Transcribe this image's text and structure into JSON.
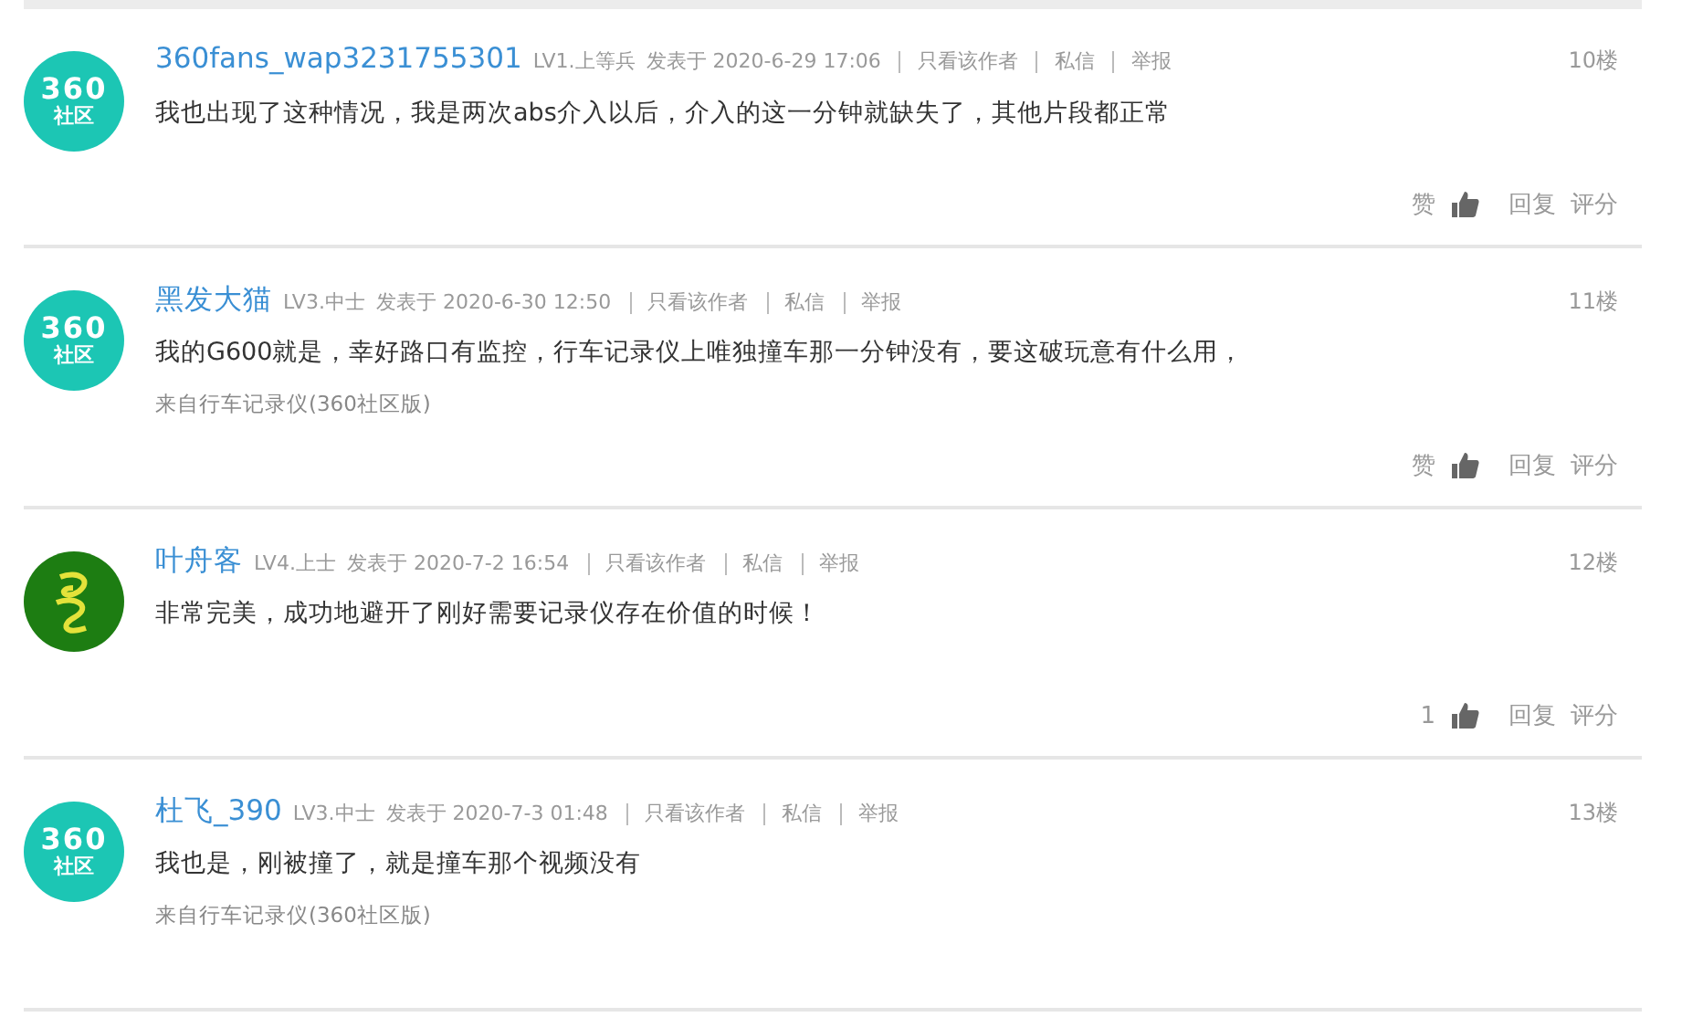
{
  "posts": [
    {
      "avatar": {
        "kind": "logo",
        "lines": [
          "360",
          "社区"
        ]
      },
      "author": "360fans_wap3231755301",
      "level": "LV1.上等兵",
      "posted": "发表于 2020-6-29 17:06",
      "links": [
        "只看该作者",
        "私信",
        "举报"
      ],
      "floor": "10楼",
      "content": "我也出现了这种情况，我是两次abs介入以后，介入的这一分钟就缺失了，其他片段都正常",
      "actions": {
        "like": "赞",
        "reply": "回复",
        "rate": "评分"
      }
    },
    {
      "avatar": {
        "kind": "logo",
        "lines": [
          "360",
          "社区"
        ]
      },
      "author": "黑发大猫",
      "level": "LV3.中士",
      "posted": "发表于 2020-6-30 12:50",
      "links": [
        "只看该作者",
        "私信",
        "举报"
      ],
      "floor": "11楼",
      "content": "我的G600就是，幸好路口有监控，行车记录仪上唯独撞车那一分钟没有，要这破玩意有什么用，",
      "source": "来自行车记录仪(360社区版)",
      "actions": {
        "like": "赞",
        "reply": "回复",
        "rate": "评分"
      }
    },
    {
      "avatar": {
        "kind": "picture"
      },
      "author": "叶舟客",
      "level": "LV4.上士",
      "posted": "发表于 2020-7-2 16:54",
      "links": [
        "只看该作者",
        "私信",
        "举报"
      ],
      "floor": "12楼",
      "content": "非常完美，成功地避开了刚好需要记录仪存在价值的时候！",
      "actions": {
        "like": "1",
        "reply": "回复",
        "rate": "评分"
      }
    },
    {
      "avatar": {
        "kind": "logo",
        "lines": [
          "360",
          "社区"
        ]
      },
      "author": "杜飞_390",
      "level": "LV3.中士",
      "posted": "发表于 2020-7-3 01:48",
      "links": [
        "只看该作者",
        "私信",
        "举报"
      ],
      "floor": "13楼",
      "content": "我也是，刚被撞了，就是撞车那个视频没有",
      "source": "来自行车记录仪(360社区版)"
    }
  ]
}
